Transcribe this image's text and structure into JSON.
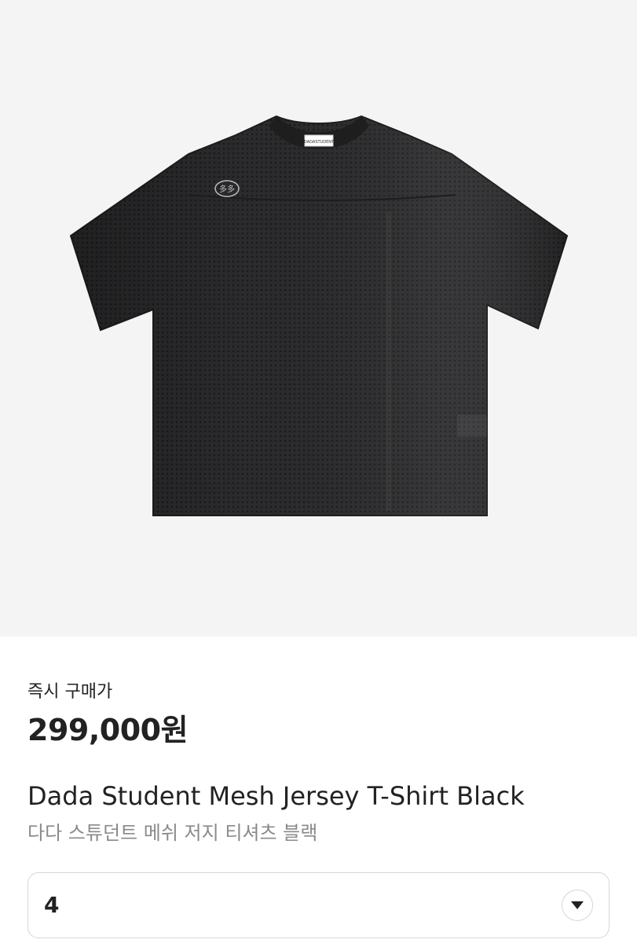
{
  "product": {
    "image_alt": "black mesh jersey t-shirt",
    "neck_label_text": "DADASTUDENT",
    "chest_logo_text": "多多",
    "price_label": "즉시 구매가",
    "price": "299,000원",
    "name_en": "Dada Student Mesh Jersey T-Shirt Black",
    "name_ko": "다다 스튜던트 메쉬 저지 티셔츠 블랙"
  },
  "size_select": {
    "selected": "4",
    "icon": "chevron-down-icon"
  },
  "colors": {
    "image_bg": "#f4f4f4",
    "shirt": "#2a2a2c",
    "text_primary": "#222222",
    "text_secondary": "#8a8a8a",
    "border": "#d6d6d6"
  }
}
